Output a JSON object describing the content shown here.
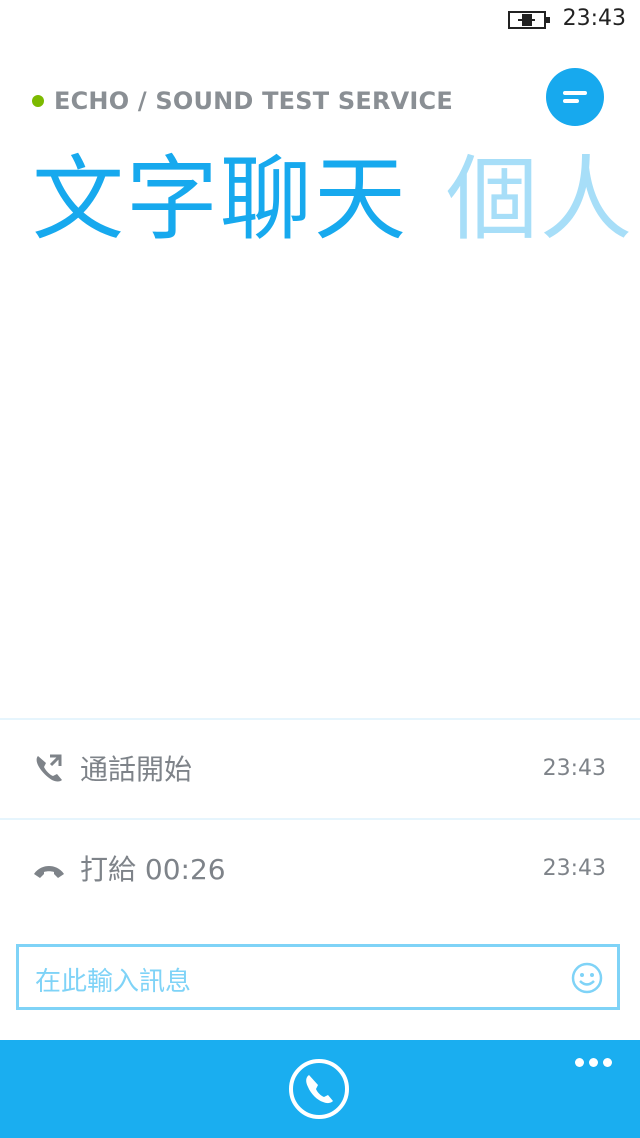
{
  "status_bar": {
    "time": "23:43",
    "battery_icon": "battery-charging-icon"
  },
  "header": {
    "contact_name": "ECHO / SOUND TEST SERVICE",
    "presence_color": "#7cba00",
    "menu_icon": "menu-lines-icon"
  },
  "pivot": {
    "active_tab": "文字聊天",
    "next_tab": "個人"
  },
  "events": [
    {
      "icon": "call-started-icon",
      "text": "通話開始",
      "time": "23:43"
    },
    {
      "icon": "call-ended-icon",
      "text": "打給 00:26",
      "time": "23:43"
    }
  ],
  "composer": {
    "placeholder": "在此輸入訊息",
    "emoji_icon": "smiley-icon"
  },
  "app_bar": {
    "call_icon": "phone-icon",
    "more_icon": "ellipsis-icon"
  },
  "colors": {
    "accent": "#17a9ee",
    "accent_light": "#a7def8",
    "app_bar": "#1aaef0",
    "secondary_text": "#7e8389"
  }
}
